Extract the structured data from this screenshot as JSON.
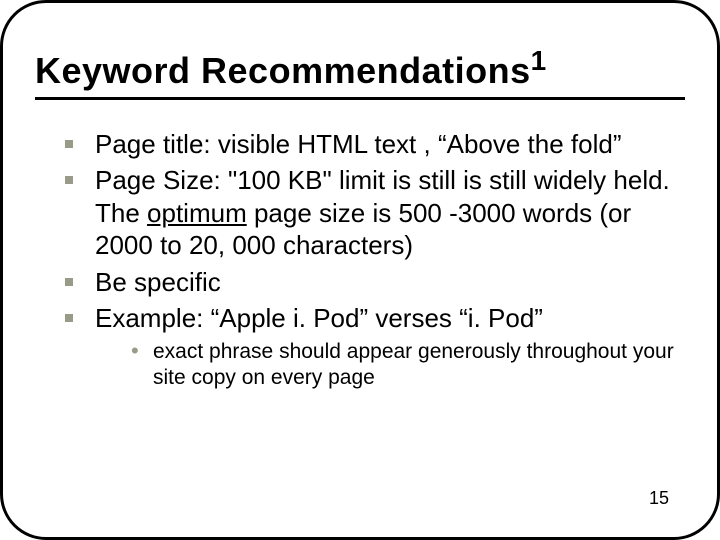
{
  "title_main": "Keyword Recommendations",
  "title_super": "1",
  "bullets": [
    {
      "text": "Page title: visible HTML text , “Above the fold”"
    },
    {
      "pre": "Page Size: \"100 KB\" limit is still is still widely held. The ",
      "u": "optimum",
      "post": " page size is 500 -3000 words (or 2000 to 20, 000 characters)"
    },
    {
      "text": "Be specific"
    },
    {
      "text": "Example: “Apple i. Pod” verses “i. Pod”"
    }
  ],
  "subbullets": [
    "exact phrase should appear generously throughout your site copy on every page"
  ],
  "page_number": "15"
}
